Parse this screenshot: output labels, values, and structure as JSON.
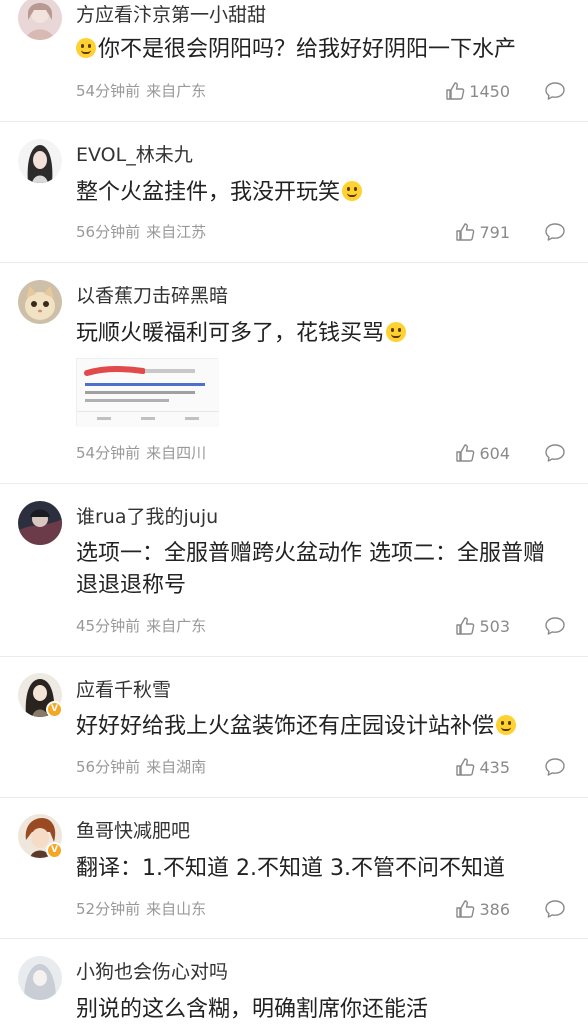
{
  "comments": [
    {
      "username": "方应看汴京第一小甜甜",
      "text": "你不是很会阴阳吗？给我好好阴阳一下水产",
      "time": "54分钟前",
      "location": "来自广东",
      "likes": "1450",
      "emoji": "smile-emoji"
    },
    {
      "username": "EVOL_林未九",
      "text": "整个火盆挂件，我没开玩笑",
      "time": "56分钟前",
      "location": "来自江苏",
      "likes": "791",
      "emoji": "crying-laugh-emoji"
    },
    {
      "username": "以香蕉刀击碎黑暗",
      "text": "玩顺火暖福利可多了，花钱买骂",
      "time": "54分钟前",
      "location": "来自四川",
      "likes": "604",
      "emoji": "salute-emoji"
    },
    {
      "username": "谁rua了我的juju",
      "text": "选项一：全服普赠跨火盆动作 选项二：全服普赠退退退称号",
      "time": "45分钟前",
      "location": "来自广东",
      "likes": "503"
    },
    {
      "username": "应看千秋雪",
      "text": "好好好给我上火盆装饰还有庄园设计站补偿",
      "time": "56分钟前",
      "location": "来自湖南",
      "likes": "435",
      "emoji": "smile-emoji"
    },
    {
      "username": "鱼哥快减肥吧",
      "text": "翻译：1.不知道 2.不知道 3.不管不问不知道",
      "time": "52分钟前",
      "location": "来自山东",
      "likes": "386"
    },
    {
      "username": "小狗也会伤心对吗",
      "text": "别说的这么含糊，明确割席你还能活"
    }
  ]
}
